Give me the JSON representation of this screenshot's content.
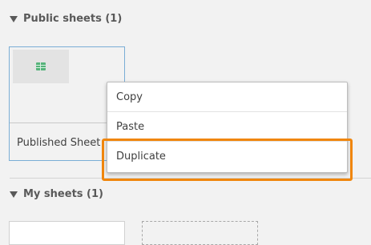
{
  "public_section": {
    "title": "Public sheets (1)"
  },
  "my_section": {
    "title": "My sheets (1)"
  },
  "sheet_card": {
    "title": "Published Sheet"
  },
  "context_menu": {
    "items": [
      {
        "label": "Copy"
      },
      {
        "label": "Paste"
      },
      {
        "label": "Duplicate"
      }
    ]
  },
  "colors": {
    "highlight": "#f0860d",
    "card_border": "#7aaed6",
    "sheet_icon": "#56b37a"
  }
}
